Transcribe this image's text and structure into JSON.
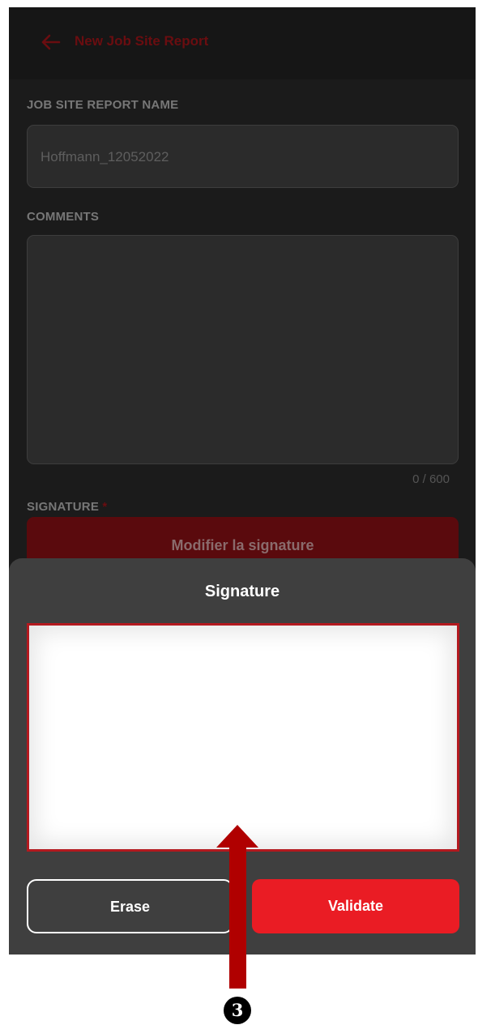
{
  "app_bar": {
    "title": "New Job Site Report",
    "back_icon": "arrow-left-icon",
    "accent_color": "#6a0d10"
  },
  "form": {
    "name_label": "JOB SITE REPORT NAME",
    "name_value": "Hoffmann_12052022",
    "comments_label": "COMMENTS",
    "comments_value": "",
    "comments_counter": "0 / 600",
    "signature_label": "SIGNATURE",
    "required_marker": "*",
    "modify_signature_label": "Modifier la signature"
  },
  "signature_sheet": {
    "title": "Signature",
    "erase_label": "Erase",
    "validate_label": "Validate",
    "validate_color": "#ea1c24",
    "pad_border_color": "#b3191f"
  },
  "annotation": {
    "step_number": "3",
    "arrow_color": "#b00000"
  }
}
